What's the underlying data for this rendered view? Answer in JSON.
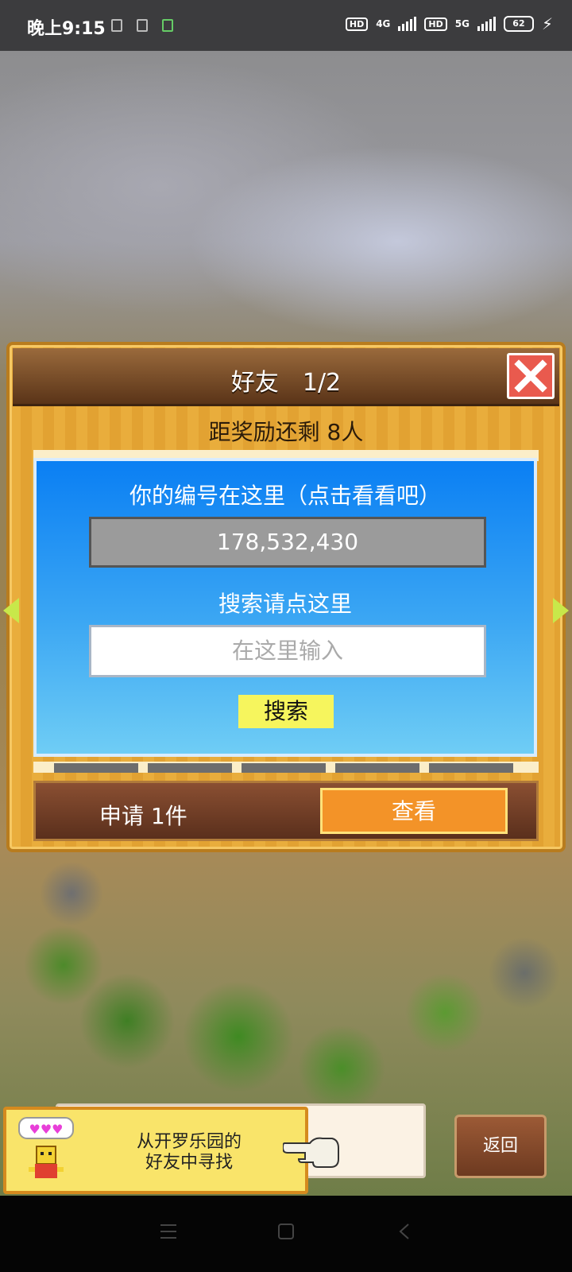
{
  "status_bar": {
    "time": "晚上9:15",
    "hd1": "HD",
    "net1": "4G",
    "hd2": "HD",
    "net2": "5G",
    "battery": "62"
  },
  "dialog": {
    "title": "好友　1/2",
    "reward_text": "距奖励还剩 8人",
    "panel": {
      "your_id_label": "你的编号在这里（点击看看吧）",
      "your_id_value": "178,532,430",
      "search_label": "搜索请点这里",
      "search_placeholder": "在这里输入",
      "search_button": "搜索"
    },
    "footer": {
      "request_text": "申请 1件",
      "view_button": "查看"
    }
  },
  "banner": {
    "text_line1": "从开罗乐园的",
    "text_line2": "好友中寻找"
  },
  "back_button": "返回",
  "colors": {
    "dialog_wood": "#e9ad3c",
    "header_brown": "#5a3418",
    "close_red": "#e95a4e",
    "panel_blue": "#0a7ff3",
    "search_yellow": "#f6f55d",
    "view_orange": "#f39328"
  }
}
